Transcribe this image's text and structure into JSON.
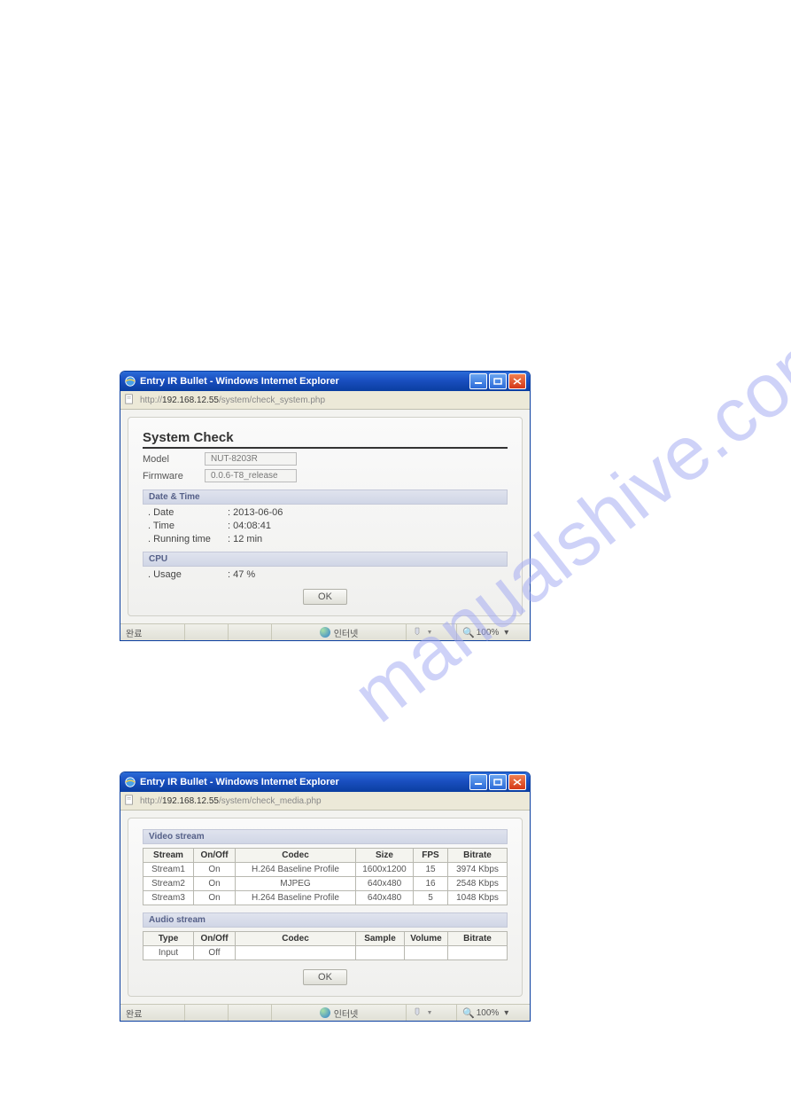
{
  "watermark": "manualshive.com",
  "window1": {
    "title": "Entry IR Bullet - Windows Internet Explorer",
    "url_prefix": "http://",
    "url_ip": "192.168.12.55",
    "url_path": "/system/check_system.php",
    "page_title": "System Check",
    "model_label": "Model",
    "model_value": "NUT-8203R",
    "firmware_label": "Firmware",
    "firmware_value": "0.0.6-T8_release",
    "section_datetime": "Date & Time",
    "date_label": ". Date",
    "date_value": ": 2013-06-06",
    "time_label": ". Time",
    "time_value": ": 04:08:41",
    "running_label": ". Running time",
    "running_value": ": 12 min",
    "section_cpu": "CPU",
    "usage_label": ". Usage",
    "usage_value": ": 47 %",
    "ok": "OK",
    "status_done": "완료",
    "status_net": "인터넷",
    "zoom": "100%"
  },
  "window2": {
    "title": "Entry IR Bullet - Windows Internet Explorer",
    "url_prefix": "http://",
    "url_ip": "192.168.12.55",
    "url_path": "/system/check_media.php",
    "section_video": "Video stream",
    "video_headers": [
      "Stream",
      "On/Off",
      "Codec",
      "Size",
      "FPS",
      "Bitrate"
    ],
    "video_rows": [
      {
        "c0": "Stream1",
        "c1": "On",
        "c2": "H.264 Baseline Profile",
        "c3": "1600x1200",
        "c4": "15",
        "c5": "3974 Kbps"
      },
      {
        "c0": "Stream2",
        "c1": "On",
        "c2": "MJPEG",
        "c3": "640x480",
        "c4": "16",
        "c5": "2548 Kbps"
      },
      {
        "c0": "Stream3",
        "c1": "On",
        "c2": "H.264 Baseline Profile",
        "c3": "640x480",
        "c4": "5",
        "c5": "1048 Kbps"
      }
    ],
    "section_audio": "Audio stream",
    "audio_headers": [
      "Type",
      "On/Off",
      "Codec",
      "Sample",
      "Volume",
      "Bitrate"
    ],
    "audio_rows": [
      {
        "c0": "Input",
        "c1": "Off",
        "c2": "",
        "c3": "",
        "c4": "",
        "c5": ""
      }
    ],
    "ok": "OK",
    "status_done": "완료",
    "status_net": "인터넷",
    "zoom": "100%"
  }
}
